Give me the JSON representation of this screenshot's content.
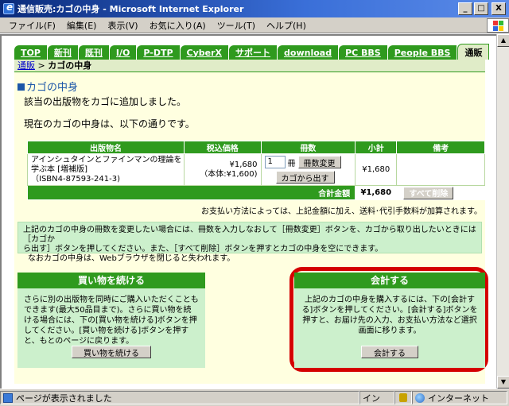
{
  "window": {
    "title": "通信販売:カゴの中身 - Microsoft Internet Explorer",
    "minimize": "_",
    "maximize": "□",
    "close": "X"
  },
  "menu": {
    "items": [
      "ファイル(F)",
      "編集(E)",
      "表示(V)",
      "お気に入り(A)",
      "ツール(T)",
      "ヘルプ(H)"
    ]
  },
  "nav": {
    "tabs": [
      "TOP",
      "新刊",
      "既刊",
      "I/O",
      "P-DTP",
      "CyberX",
      "サポート",
      "download",
      "PC BBS",
      "People BBS",
      "通販"
    ],
    "active_index": 10
  },
  "breadcrumb": {
    "link": "通販",
    "separator": " > ",
    "current": "カゴの中身"
  },
  "page": {
    "heading": "カゴの中身",
    "message_added": "該当の出版物をカゴに追加しました。",
    "message_current": "現在のカゴの中身は、以下の通りです。"
  },
  "cart": {
    "headers": [
      "出版物名",
      "税込価格",
      "冊数",
      "小計",
      "備考"
    ],
    "items": [
      {
        "name_line1": "アインシュタインとファインマンの理論を学ぶ本 [増補版]",
        "name_line2": "（ISBN4-87593-241-3)",
        "price": "¥1,680",
        "price_note": "（本体:¥1,600)",
        "qty": "1",
        "qty_unit": "冊",
        "change_button": "冊数変更",
        "remove_button": "カゴから出す",
        "subtotal": "¥1,680",
        "note": ""
      }
    ],
    "total_label": "合計金額",
    "total": "¥1,680",
    "delete_all_button": "すべて削除"
  },
  "shipping_note": "お支払い方法によっては、上記金額に加え、送料･代引手数料が加算されます。",
  "info": {
    "line1": "上記のカゴの中身の冊数を変更したい場合には、冊数を入力しなおして［冊数変更］ボタンを、カゴから取り出したいときには［カゴか",
    "line2": "ら出す］ボタンを押してください。また、［すべて削除］ボタンを押すとカゴの中身を空にできます。",
    "line3": "なおカゴの中身は、Webブラウザを閉じると失われます。"
  },
  "continue_panel": {
    "title": "買い物を続ける",
    "body": "さらに別の出版物を同時にご購入いただくこともできます(最大50品目まで)。さらに買い物を続ける場合には、下の[買い物を続ける]ボタンを押してください。[買い物を続ける]ボタンを押すと、もとのページに戻ります。",
    "button": "買い物を続ける"
  },
  "checkout_panel": {
    "title": "会計する",
    "body": "上記のカゴの中身を購入するには、下の[会計する]ボタンを押してください。[会計する]ボタンを押すと、お届け先の入力、お支払い方法など選択画面に移ります。",
    "button": "会計する"
  },
  "status": {
    "text": "ページが表示されました",
    "ime": "イン",
    "zone": "インターネット"
  },
  "colors": {
    "nav_green": "#2f9a1e",
    "panel_green": "#ccf0cc",
    "page_bg": "#ffffe0",
    "highlight_ring": "#d40000",
    "heading_blue": "#1c56a8"
  }
}
